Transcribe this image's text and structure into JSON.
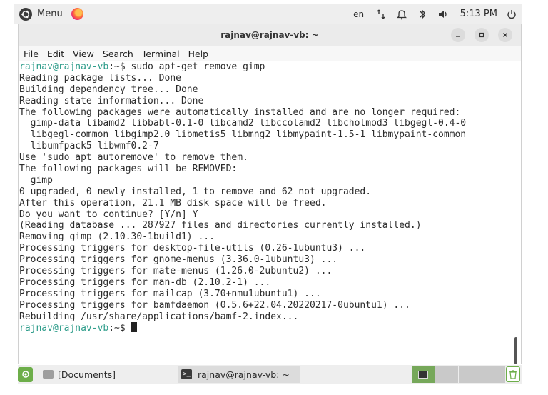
{
  "top_panel": {
    "menu_label": "Menu",
    "language": "en",
    "clock": "5:13 PM",
    "icons": [
      "ubuntu-logo-icon",
      "firefox-icon",
      "network-icon",
      "notifications-icon",
      "bluetooth-icon",
      "volume-icon",
      "power-icon"
    ]
  },
  "window": {
    "title": "rajnav@rajnav-vb: ~",
    "menu": [
      "File",
      "Edit",
      "View",
      "Search",
      "Terminal",
      "Help"
    ]
  },
  "terminal": {
    "prompt_user": "rajnav@rajnav-vb",
    "prompt_path": ":~$ ",
    "lines": [
      {
        "prompt": true,
        "text": "sudo apt-get remove gimp"
      },
      {
        "text": "Reading package lists... Done"
      },
      {
        "text": "Building dependency tree... Done"
      },
      {
        "text": "Reading state information... Done"
      },
      {
        "text": "The following packages were automatically installed and are no longer required:"
      },
      {
        "text": "  gimp-data libamd2 libbabl-0.1-0 libcamd2 libccolamd2 libcholmod3 libgegl-0.4-0"
      },
      {
        "text": "  libgegl-common libgimp2.0 libmetis5 libmng2 libmypaint-1.5-1 libmypaint-common"
      },
      {
        "text": "  libumfpack5 libwmf0.2-7"
      },
      {
        "text": "Use 'sudo apt autoremove' to remove them."
      },
      {
        "text": "The following packages will be REMOVED:"
      },
      {
        "text": "  gimp"
      },
      {
        "text": "0 upgraded, 0 newly installed, 1 to remove and 62 not upgraded."
      },
      {
        "text": "After this operation, 21.1 MB disk space will be freed."
      },
      {
        "text": "Do you want to continue? [Y/n] Y"
      },
      {
        "text": "(Reading database ... 287927 files and directories currently installed.)"
      },
      {
        "text": "Removing gimp (2.10.30-1build1) ..."
      },
      {
        "text": "Processing triggers for desktop-file-utils (0.26-1ubuntu3) ..."
      },
      {
        "text": "Processing triggers for gnome-menus (3.36.0-1ubuntu3) ..."
      },
      {
        "text": "Processing triggers for mate-menus (1.26.0-2ubuntu2) ..."
      },
      {
        "text": "Processing triggers for man-db (2.10.2-1) ..."
      },
      {
        "text": "Processing triggers for mailcap (3.70+nmu1ubuntu1) ..."
      },
      {
        "text": "Processing triggers for bamfdaemon (0.5.6+22.04.20220217-0ubuntu1) ..."
      },
      {
        "text": "Rebuilding /usr/share/applications/bamf-2.index..."
      },
      {
        "prompt": true,
        "text": "",
        "cursor": true
      }
    ]
  },
  "bottom_panel": {
    "tasks": [
      {
        "label": "[Documents]",
        "icon": "folder-icon"
      },
      {
        "label": "rajnav@rajnav-vb: ~",
        "icon": "terminal-icon"
      }
    ]
  },
  "colors": {
    "prompt": "#2f9d8b",
    "accent_green": "#76a85a"
  }
}
